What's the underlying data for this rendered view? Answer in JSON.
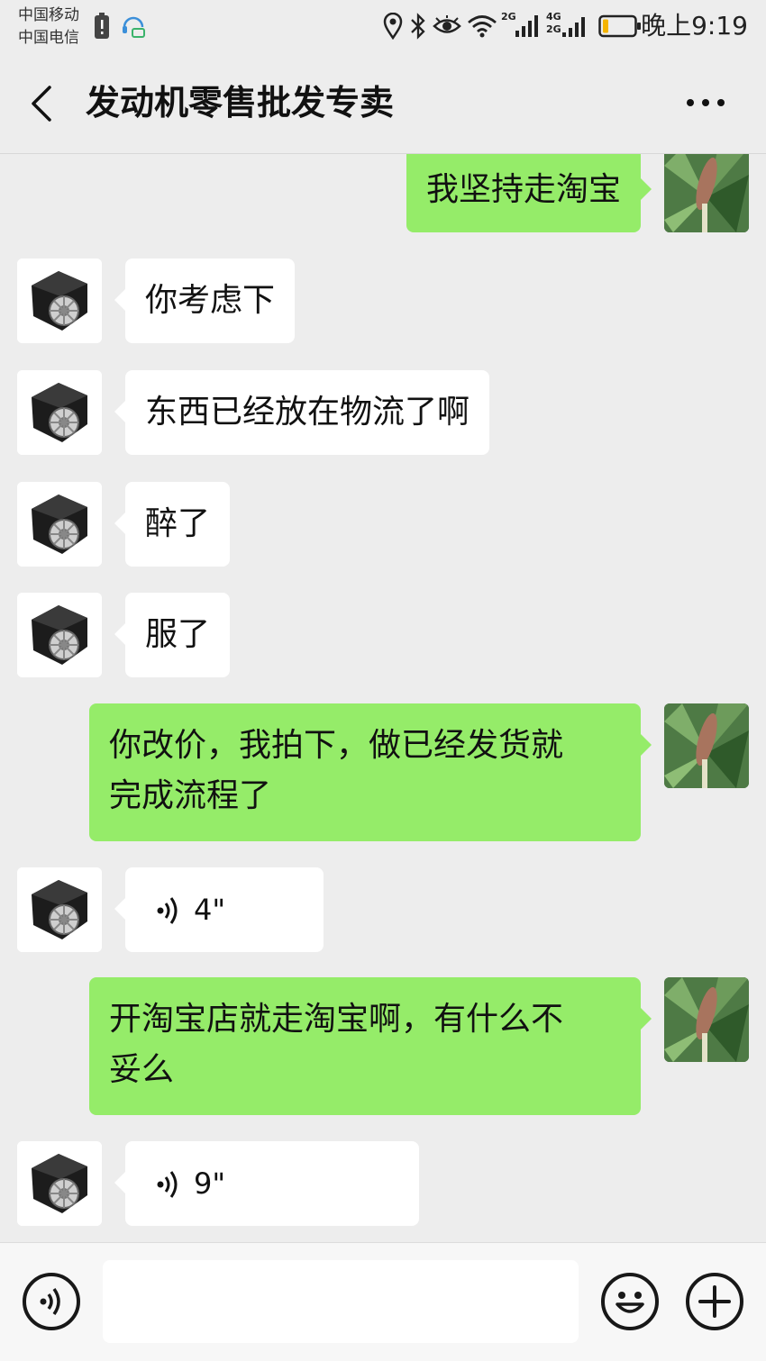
{
  "status_bar": {
    "carrier_1": "中国移动",
    "carrier_2": "中国电信",
    "net_1": "2G",
    "net_2_top": "4G",
    "net_2_bottom": "2G",
    "time": "晚上9:19",
    "battery_level": 0.15
  },
  "header": {
    "title": "发动机零售批发专卖"
  },
  "messages": [
    {
      "side": "out",
      "type": "text",
      "text": "我坚持走淘宝"
    },
    {
      "side": "in",
      "type": "text",
      "text": "你考虑下"
    },
    {
      "side": "in",
      "type": "text",
      "text": "东西已经放在物流了啊"
    },
    {
      "side": "in",
      "type": "text",
      "text": "醉了"
    },
    {
      "side": "in",
      "type": "text",
      "text": "服了"
    },
    {
      "side": "out",
      "type": "text",
      "text_line1": "你改价，我拍下，做已经发货就",
      "text_line2": "完成流程了"
    },
    {
      "side": "in",
      "type": "voice",
      "duration": "4\""
    },
    {
      "side": "out",
      "type": "text",
      "text_line1": "开淘宝店就走淘宝啊，有什么不",
      "text_line2": "妥么"
    },
    {
      "side": "in",
      "type": "voice",
      "duration": "9\""
    }
  ],
  "input_bar": {
    "text_value": "",
    "voice_icon": "voice-icon",
    "emoji_icon": "emoji-icon",
    "plus_icon": "plus-icon"
  },
  "colors": {
    "background": "#ededed",
    "outgoing_bubble": "#95ec69",
    "incoming_bubble": "#ffffff",
    "battery": "#f5b400"
  }
}
